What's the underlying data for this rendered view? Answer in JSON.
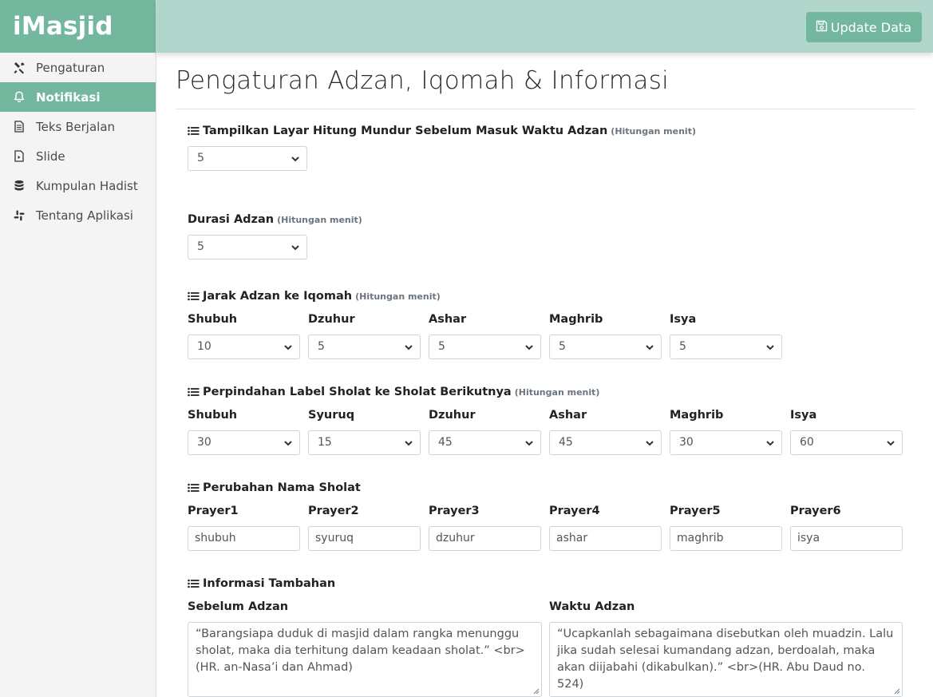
{
  "brand": "iMasjid",
  "sidebar": {
    "items": [
      {
        "label": "Pengaturan",
        "icon": "tools-icon"
      },
      {
        "label": "Notifikasi",
        "icon": "bell-icon",
        "active": true
      },
      {
        "label": "Teks Berjalan",
        "icon": "document-icon"
      },
      {
        "label": "Slide",
        "icon": "file-icon"
      },
      {
        "label": "Kumpulan Hadist",
        "icon": "database-icon"
      },
      {
        "label": "Tentang Aplikasi",
        "icon": "slack-icon"
      }
    ]
  },
  "topbar": {
    "update_label": "Update Data"
  },
  "page": {
    "title": "Pengaturan Adzan, Iqomah & Informasi"
  },
  "countdown": {
    "title": "Tampilkan Layar Hitung Mundur Sebelum Masuk Waktu Adzan",
    "hint": "(Hitungan menit)",
    "value": "5"
  },
  "adzan_duration": {
    "title": "Durasi Adzan",
    "hint": "(Hitungan menit)",
    "value": "5"
  },
  "iqomah_gap": {
    "title": "Jarak Adzan ke Iqomah",
    "hint": "(Hitungan menit)",
    "fields": [
      {
        "label": "Shubuh",
        "value": "10"
      },
      {
        "label": "Dzuhur",
        "value": "5"
      },
      {
        "label": "Ashar",
        "value": "5"
      },
      {
        "label": "Maghrib",
        "value": "5"
      },
      {
        "label": "Isya",
        "value": "5"
      }
    ]
  },
  "label_shift": {
    "title": "Perpindahan Label Sholat ke Sholat Berikutnya",
    "hint": "(Hitungan menit)",
    "fields": [
      {
        "label": "Shubuh",
        "value": "30"
      },
      {
        "label": "Syuruq",
        "value": "15"
      },
      {
        "label": "Dzuhur",
        "value": "45"
      },
      {
        "label": "Ashar",
        "value": "45"
      },
      {
        "label": "Maghrib",
        "value": "30"
      },
      {
        "label": "Isya",
        "value": "60"
      }
    ]
  },
  "prayer_names": {
    "title": "Perubahan Nama Sholat",
    "fields": [
      {
        "label": "Prayer1",
        "value": "shubuh"
      },
      {
        "label": "Prayer2",
        "value": "syuruq"
      },
      {
        "label": "Prayer3",
        "value": "dzuhur"
      },
      {
        "label": "Prayer4",
        "value": "ashar"
      },
      {
        "label": "Prayer5",
        "value": "maghrib"
      },
      {
        "label": "Prayer6",
        "value": "isya"
      }
    ]
  },
  "extra_info": {
    "title": "Informasi Tambahan",
    "before": {
      "label": "Sebelum Adzan",
      "value": "“Barangsiapa duduk di masjid dalam rangka menunggu sholat, maka dia terhitung dalam keadaan sholat.” <br>(HR. an-Nasa’i dan Ahmad)"
    },
    "during": {
      "label": "Waktu Adzan",
      "value": "“Ucapkanlah sebagaimana disebutkan oleh muadzin. Lalu jika sudah selesai kumandang adzan, berdoalah, maka akan diijabahi (dikabulkan).” <br>(HR. Abu Daud no. 524)"
    }
  },
  "colors": {
    "accent": "#72b79e",
    "topbar": "#b1d6cb",
    "sidebar_bg": "#f4f4f4"
  }
}
